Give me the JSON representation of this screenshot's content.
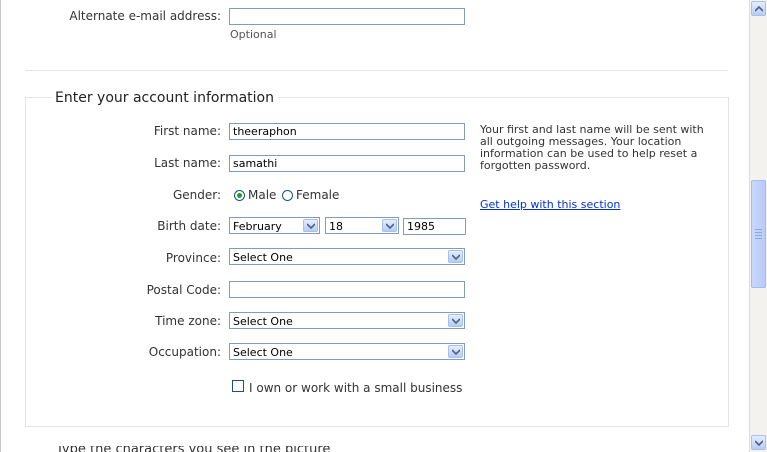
{
  "top": {
    "alt_email_label": "Alternate e-mail address:",
    "alt_email_value": "",
    "alt_email_hint": "Optional"
  },
  "section": {
    "title": "Enter your account information",
    "first_name_label": "First name:",
    "first_name_value": "theeraphon",
    "last_name_label": "Last name:",
    "last_name_value": "samathi",
    "gender_label": "Gender:",
    "gender_male": "Male",
    "gender_female": "Female",
    "gender_selected": "Male",
    "birth_label": "Birth date:",
    "birth_month": "February",
    "birth_day": "18",
    "birth_year": "1985",
    "province_label": "Province:",
    "province_value": "Select One",
    "postal_label": "Postal Code:",
    "postal_value": "",
    "timezone_label": "Time zone:",
    "timezone_value": "Select One",
    "occupation_label": "Occupation:",
    "occupation_value": "Select One",
    "business_check_label": "I own or work with a small business",
    "business_checked": false
  },
  "help": {
    "text": "Your first and last name will be sent with all outgoing messages. Your location information can be used to help reset a forgotten password.",
    "link": "Get help with this section"
  },
  "next_section_partial": "Type the characters you see in the picture"
}
